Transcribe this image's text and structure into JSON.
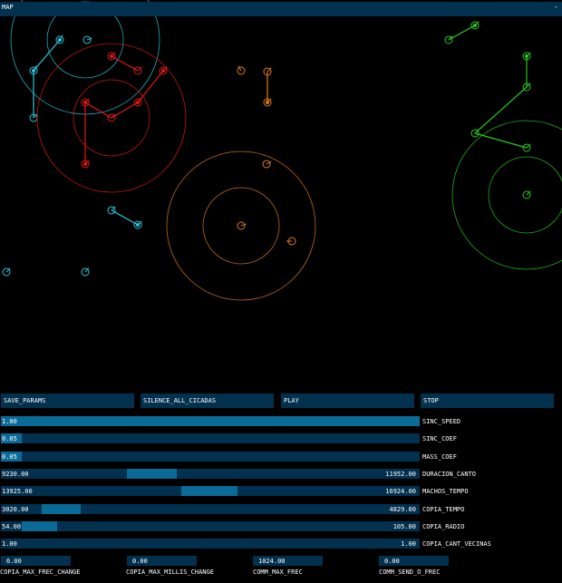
{
  "window": {
    "title": "MAP",
    "minimize_glyph": "-"
  },
  "buttons": [
    "SAVE_PARAMS",
    "SILENCE_ALL_CICADAS",
    "PLAY",
    "STOP"
  ],
  "sliders": [
    {
      "label": "SINC_SPEED",
      "value": "1.00",
      "fill_from": 0.0,
      "fill_to": 1.0
    },
    {
      "label": "SINC_COEF",
      "value": "0.05",
      "fill_from": 0.0,
      "fill_to": 0.05
    },
    {
      "label": "MASS_COEF",
      "value": "0.05",
      "fill_from": 0.0,
      "fill_to": 0.05
    },
    {
      "label": "DURACION_CANTO",
      "min_value": "9230.00",
      "max_value": "11952.00",
      "fill_from": 0.3,
      "fill_to": 0.42
    },
    {
      "label": "MACHOS_TEMPO",
      "min_value": "13925.00",
      "max_value": "16924.00",
      "fill_from": 0.43,
      "fill_to": 0.565
    },
    {
      "label": "COPIA_TEMPO",
      "min_value": "3020.00",
      "max_value": "4829.00",
      "fill_from": 0.097,
      "fill_to": 0.19
    },
    {
      "label": "COPIA_RADIO",
      "min_value": "54.00",
      "max_value": "105.00",
      "fill_from": 0.05,
      "fill_to": 0.135
    },
    {
      "label": "COPIA_CANT_VECINAS",
      "min_value": "1.00",
      "max_value": "1.00",
      "fill_from": 0.0,
      "fill_to": 0.0
    }
  ],
  "numbers": [
    {
      "label": "COPIA_MAX_FREC_CHANGE",
      "value": "6.00"
    },
    {
      "label": "COPIA_MAX_MILLIS_CHANGE",
      "value": "0.00"
    },
    {
      "label": "COMM_MAX_FREC",
      "value": "1024.00"
    },
    {
      "label": "COMM_SEND_O_FREC",
      "value": "0.00"
    }
  ],
  "colors": {
    "background": "#000000",
    "panel": "#02304f",
    "accent": "#0a6a98",
    "cyan": "#29c7d8",
    "red": "#e01717",
    "orange": "#e07a1c",
    "green": "#27c81f"
  }
}
